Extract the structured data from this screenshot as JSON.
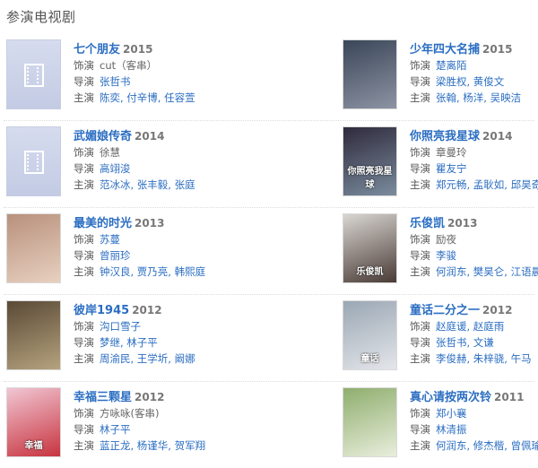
{
  "section_title": "参演电视剧",
  "labels": {
    "role": "饰演",
    "director": "导演",
    "cast": "主演"
  },
  "rows": [
    [
      {
        "title": "七个朋友",
        "year": "2015",
        "poster": "placeholder",
        "role": "cut（客串）",
        "role_linked": false,
        "director": "张哲书",
        "cast": "陈奕, 付辛博, 任容萱"
      },
      {
        "title": "少年四大名捕",
        "year": "2015",
        "poster": "image",
        "poster_color": "#3a4658",
        "poster_color2": "#8d93a3",
        "role": "楚离陌",
        "role_linked": true,
        "director": "梁胜权, 黄俊文",
        "cast": "张翰, 杨洋, 吴映洁"
      }
    ],
    [
      {
        "title": "武媚娘传奇",
        "year": "2014",
        "poster": "placeholder",
        "role": "徐慧",
        "role_linked": false,
        "director": "高翊浚",
        "cast": "范冰冰, 张丰毅, 张庭"
      },
      {
        "title": "你照亮我星球",
        "year": "2014",
        "poster": "image",
        "poster_color": "#2f2a3c",
        "poster_color2": "#7a8c9e",
        "poster_text": "你照亮我星球",
        "role": "章曼玲",
        "role_linked": false,
        "director": "瞿友宁",
        "cast": "郑元畅, 孟耿如, 邱昊奇"
      }
    ],
    [
      {
        "title": "最美的时光",
        "year": "2013",
        "poster": "image",
        "poster_color": "#b8917c",
        "poster_color2": "#e8d0c0",
        "role": "苏蔓",
        "role_linked": true,
        "director": "曾丽珍",
        "cast": "钟汉良, 贾乃亮, 韩熙庭"
      },
      {
        "title": "乐俊凯",
        "year": "2013",
        "poster": "image",
        "poster_color": "#d9d6d2",
        "poster_color2": "#4a3b36",
        "poster_text": "乐俊凯",
        "role": "励夜",
        "role_linked": false,
        "director": "李骏",
        "cast": "何润东, 樊昊仑, 江语晨"
      }
    ],
    [
      {
        "title": "彼岸1945",
        "year": "2012",
        "poster": "image",
        "poster_color": "#5a4a36",
        "poster_color2": "#b5a27e",
        "role": "沟口雪子",
        "role_linked": true,
        "director": "梦继, 林子平",
        "cast": "周渝民, 王学圻, 阚娜"
      },
      {
        "title": "童话二分之一",
        "year": "2012",
        "poster": "image",
        "poster_color": "#9aa7b4",
        "poster_color2": "#e4e6ea",
        "poster_text": "童话",
        "role": "赵庭谖, 赵庭雨",
        "role_linked": true,
        "director": "张哲书, 文谦",
        "cast": "李俊赫, 朱梓骁, 午马"
      }
    ],
    [
      {
        "title": "幸福三颗星",
        "year": "2012",
        "poster": "image",
        "poster_color": "#f1c6d3",
        "poster_color2": "#c7343f",
        "poster_text": "幸福",
        "role": "方咏咏(客串)",
        "role_linked": false,
        "director": "林子平",
        "cast": "蓝正龙, 杨谨华, 贺军翔"
      },
      {
        "title": "真心请按两次铃",
        "year": "2011",
        "poster": "image",
        "poster_color": "#8fae6e",
        "poster_color2": "#e9eedc",
        "role": "郑小襄",
        "role_linked": true,
        "director": "林清振",
        "cast": "何润东, 修杰楷, 曾佩瑜"
      }
    ]
  ]
}
